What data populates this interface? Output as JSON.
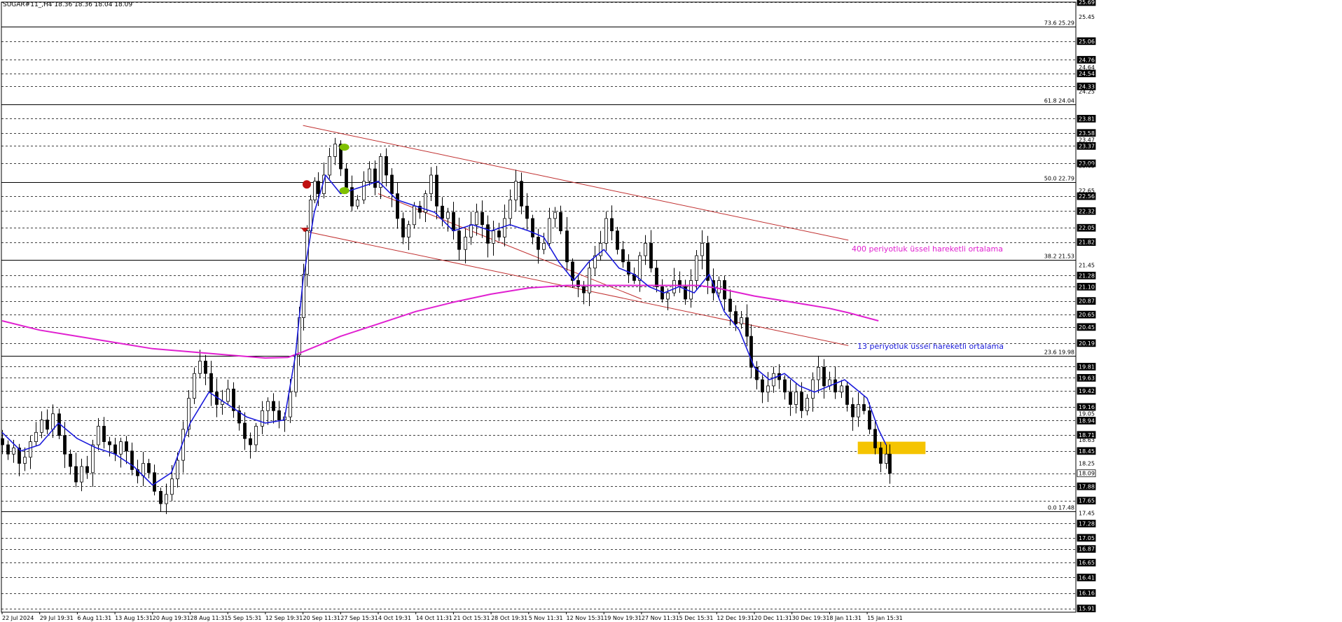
{
  "header": {
    "symbol": "SUGAR#11_,H4",
    "ohlc": "18.36 18.36 18.04 18.09"
  },
  "chart_data": {
    "type": "candlestick",
    "ylim": [
      15.85,
      25.69
    ],
    "price_ticks": [
      "25.69",
      "25.45",
      "25.06",
      "24.76",
      "24.64",
      "24.54",
      "24.33",
      "24.25",
      "23.81",
      "23.58",
      "23.47",
      "23.37",
      "23.09",
      "23.05",
      "22.65",
      "22.56",
      "22.32",
      "22.05",
      "21.82",
      "21.45",
      "21.28",
      "21.10",
      "20.87",
      "20.65",
      "20.45",
      "20.19",
      "19.81",
      "19.63",
      "19.42",
      "19.16",
      "19.05",
      "18.94",
      "18.71",
      "18.63",
      "18.45",
      "18.25",
      "18.09",
      "17.88",
      "17.65",
      "17.45",
      "17.28",
      "17.05",
      "16.87",
      "16.65",
      "16.41",
      "16.16",
      "15.91"
    ],
    "boxed_price_ticks": [
      "25.69",
      "25.06",
      "24.76",
      "24.54",
      "24.33",
      "23.81",
      "23.58",
      "23.37",
      "23.09",
      "22.56",
      "22.32",
      "22.05",
      "21.82",
      "21.28",
      "21.10",
      "20.87",
      "20.65",
      "20.45",
      "20.19",
      "19.81",
      "19.63",
      "19.42",
      "19.16",
      "18.94",
      "18.71",
      "18.45",
      "18.09",
      "17.88",
      "17.65",
      "17.28",
      "17.05",
      "16.87",
      "16.65",
      "16.41",
      "16.16",
      "15.91"
    ],
    "current_price": "18.09",
    "time_labels": [
      "22 Jul 2024",
      "29 Jul 19:31",
      "6 Aug 11:31",
      "13 Aug 15:31",
      "20 Aug 19:31",
      "28 Aug 11:31",
      "5 Sep 15:31",
      "12 Sep 19:31",
      "20 Sep 11:31",
      "27 Sep 15:31",
      "4 Oct 19:31",
      "14 Oct 11:31",
      "21 Oct 15:31",
      "28 Oct 19:31",
      "5 Nov 11:31",
      "12 Nov 15:31",
      "19 Nov 19:31",
      "27 Nov 11:31",
      "5 Dec 15:31",
      "12 Dec 19:31",
      "20 Dec 11:31",
      "30 Dec 19:31",
      "8 Jan 11:31",
      "15 Jan 15:31"
    ],
    "fibonacci": [
      {
        "label": "73.6 25.29",
        "price": 25.29
      },
      {
        "label": "61.8 24.04",
        "price": 24.04
      },
      {
        "label": "50.0 22.79",
        "price": 22.79
      },
      {
        "label": "38.2 21.53",
        "price": 21.53
      },
      {
        "label": "23.6 19.98",
        "price": 19.98
      },
      {
        "label": "0.0 17.48",
        "price": 17.48
      }
    ],
    "channel_lines": [
      {
        "from": [
          8,
          23.7
        ],
        "to": [
          22.5,
          21.85
        ]
      },
      {
        "from": [
          8,
          22.0
        ],
        "to": [
          22.5,
          20.15
        ]
      },
      {
        "from": [
          10,
          22.6
        ],
        "to": [
          17,
          20.9
        ]
      }
    ],
    "ema13": [
      [
        0,
        18.75
      ],
      [
        0.5,
        18.45
      ],
      [
        1,
        18.55
      ],
      [
        1.5,
        18.9
      ],
      [
        2,
        18.65
      ],
      [
        2.5,
        18.5
      ],
      [
        3,
        18.4
      ],
      [
        3.5,
        18.2
      ],
      [
        4,
        17.9
      ],
      [
        4.5,
        18.1
      ],
      [
        5,
        18.9
      ],
      [
        5.5,
        19.4
      ],
      [
        6,
        19.2
      ],
      [
        6.5,
        19.0
      ],
      [
        7,
        18.9
      ],
      [
        7.5,
        18.95
      ],
      [
        7.8,
        20.0
      ],
      [
        8,
        21.2
      ],
      [
        8.3,
        22.3
      ],
      [
        8.6,
        22.9
      ],
      [
        9,
        22.6
      ],
      [
        9.5,
        22.7
      ],
      [
        10,
        22.8
      ],
      [
        10.5,
        22.5
      ],
      [
        11,
        22.4
      ],
      [
        11.5,
        22.3
      ],
      [
        12,
        22.0
      ],
      [
        12.5,
        22.1
      ],
      [
        13,
        22.0
      ],
      [
        13.5,
        22.1
      ],
      [
        14,
        22.0
      ],
      [
        14.4,
        21.9
      ],
      [
        14.8,
        21.5
      ],
      [
        15.2,
        21.2
      ],
      [
        15.6,
        21.5
      ],
      [
        16,
        21.7
      ],
      [
        16.4,
        21.4
      ],
      [
        16.8,
        21.3
      ],
      [
        17.2,
        21.1
      ],
      [
        17.6,
        21.0
      ],
      [
        18,
        21.1
      ],
      [
        18.4,
        21.0
      ],
      [
        18.8,
        21.3
      ],
      [
        19.2,
        20.7
      ],
      [
        19.6,
        20.4
      ],
      [
        20,
        19.8
      ],
      [
        20.4,
        19.6
      ],
      [
        20.8,
        19.7
      ],
      [
        21.2,
        19.5
      ],
      [
        21.6,
        19.4
      ],
      [
        22,
        19.5
      ],
      [
        22.4,
        19.6
      ],
      [
        22.8,
        19.4
      ],
      [
        23,
        19.3
      ],
      [
        23.3,
        18.8
      ],
      [
        23.5,
        18.55
      ]
    ],
    "ema400": [
      [
        0,
        20.55
      ],
      [
        1,
        20.4
      ],
      [
        2,
        20.3
      ],
      [
        3,
        20.2
      ],
      [
        4,
        20.1
      ],
      [
        5,
        20.05
      ],
      [
        6,
        20.0
      ],
      [
        7,
        19.95
      ],
      [
        7.6,
        19.96
      ],
      [
        8,
        20.05
      ],
      [
        9,
        20.3
      ],
      [
        10,
        20.5
      ],
      [
        11,
        20.7
      ],
      [
        12,
        20.85
      ],
      [
        13,
        20.98
      ],
      [
        14,
        21.08
      ],
      [
        15,
        21.12
      ],
      [
        16,
        21.12
      ],
      [
        17,
        21.12
      ],
      [
        18,
        21.12
      ],
      [
        18.5,
        21.12
      ],
      [
        19,
        21.08
      ],
      [
        20,
        20.95
      ],
      [
        21,
        20.85
      ],
      [
        22,
        20.75
      ],
      [
        22.5,
        20.68
      ],
      [
        23.3,
        20.55
      ]
    ],
    "candles": [
      [
        0.0,
        18.55
      ],
      [
        0.15,
        18.4
      ],
      [
        0.3,
        18.5
      ],
      [
        0.45,
        18.25
      ],
      [
        0.6,
        18.35
      ],
      [
        0.75,
        18.6
      ],
      [
        0.9,
        18.75
      ],
      [
        1.05,
        18.95
      ],
      [
        1.2,
        18.8
      ],
      [
        1.35,
        19.05
      ],
      [
        1.5,
        18.7
      ],
      [
        1.65,
        18.4
      ],
      [
        1.8,
        18.2
      ],
      [
        1.95,
        17.95
      ],
      [
        2.1,
        18.2
      ],
      [
        2.25,
        18.1
      ],
      [
        2.4,
        18.55
      ],
      [
        2.55,
        18.85
      ],
      [
        2.7,
        18.6
      ],
      [
        2.85,
        18.55
      ],
      [
        3.0,
        18.4
      ],
      [
        3.15,
        18.6
      ],
      [
        3.3,
        18.45
      ],
      [
        3.45,
        18.15
      ],
      [
        3.6,
        18.05
      ],
      [
        3.75,
        18.25
      ],
      [
        3.9,
        18.1
      ],
      [
        4.05,
        17.8
      ],
      [
        4.2,
        17.6
      ],
      [
        4.35,
        17.75
      ],
      [
        4.5,
        18.0
      ],
      [
        4.65,
        18.3
      ],
      [
        4.8,
        18.8
      ],
      [
        4.95,
        19.3
      ],
      [
        5.1,
        19.7
      ],
      [
        5.25,
        19.9
      ],
      [
        5.4,
        19.7
      ],
      [
        5.55,
        19.4
      ],
      [
        5.7,
        19.2
      ],
      [
        5.85,
        19.25
      ],
      [
        6.0,
        19.45
      ],
      [
        6.15,
        19.1
      ],
      [
        6.3,
        18.9
      ],
      [
        6.45,
        18.65
      ],
      [
        6.6,
        18.55
      ],
      [
        6.75,
        18.85
      ],
      [
        6.9,
        19.1
      ],
      [
        7.05,
        19.25
      ],
      [
        7.2,
        19.1
      ],
      [
        7.35,
        18.95
      ],
      [
        7.5,
        19.0
      ],
      [
        7.65,
        19.4
      ],
      [
        7.8,
        20.0
      ],
      [
        7.9,
        20.6
      ],
      [
        8.0,
        21.3
      ],
      [
        8.1,
        22.0
      ],
      [
        8.2,
        22.5
      ],
      [
        8.3,
        22.8
      ],
      [
        8.4,
        22.6
      ],
      [
        8.55,
        22.9
      ],
      [
        8.7,
        23.2
      ],
      [
        8.85,
        23.4
      ],
      [
        9.0,
        23.0
      ],
      [
        9.15,
        22.7
      ],
      [
        9.3,
        22.4
      ],
      [
        9.45,
        22.5
      ],
      [
        9.6,
        22.8
      ],
      [
        9.75,
        23.0
      ],
      [
        9.9,
        22.7
      ],
      [
        10.05,
        23.2
      ],
      [
        10.2,
        22.9
      ],
      [
        10.35,
        22.6
      ],
      [
        10.5,
        22.2
      ],
      [
        10.65,
        21.9
      ],
      [
        10.8,
        22.1
      ],
      [
        10.95,
        22.4
      ],
      [
        11.1,
        22.3
      ],
      [
        11.25,
        22.6
      ],
      [
        11.4,
        22.9
      ],
      [
        11.55,
        22.4
      ],
      [
        11.7,
        22.2
      ],
      [
        11.85,
        22.3
      ],
      [
        12.0,
        22.0
      ],
      [
        12.15,
        21.7
      ],
      [
        12.3,
        21.9
      ],
      [
        12.45,
        22.1
      ],
      [
        12.6,
        22.3
      ],
      [
        12.75,
        22.1
      ],
      [
        12.9,
        21.8
      ],
      [
        13.05,
        22.0
      ],
      [
        13.2,
        21.9
      ],
      [
        13.35,
        22.2
      ],
      [
        13.5,
        22.5
      ],
      [
        13.65,
        22.8
      ],
      [
        13.8,
        22.4
      ],
      [
        13.95,
        22.2
      ],
      [
        14.1,
        21.9
      ],
      [
        14.25,
        21.7
      ],
      [
        14.4,
        21.8
      ],
      [
        14.55,
        22.2
      ],
      [
        14.7,
        22.3
      ],
      [
        14.85,
        22.0
      ],
      [
        15.0,
        21.5
      ],
      [
        15.15,
        21.2
      ],
      [
        15.3,
        21.1
      ],
      [
        15.45,
        21.0
      ],
      [
        15.6,
        21.4
      ],
      [
        15.75,
        21.6
      ],
      [
        15.9,
        21.8
      ],
      [
        16.05,
        22.2
      ],
      [
        16.2,
        22.0
      ],
      [
        16.35,
        21.7
      ],
      [
        16.5,
        21.5
      ],
      [
        16.65,
        21.3
      ],
      [
        16.8,
        21.2
      ],
      [
        16.95,
        21.6
      ],
      [
        17.1,
        21.8
      ],
      [
        17.25,
        21.4
      ],
      [
        17.4,
        21.1
      ],
      [
        17.55,
        20.9
      ],
      [
        17.7,
        21.0
      ],
      [
        17.85,
        21.2
      ],
      [
        18.0,
        21.1
      ],
      [
        18.15,
        20.9
      ],
      [
        18.3,
        21.2
      ],
      [
        18.45,
        21.6
      ],
      [
        18.6,
        21.8
      ],
      [
        18.75,
        21.2
      ],
      [
        18.9,
        21.0
      ],
      [
        19.05,
        21.2
      ],
      [
        19.2,
        20.9
      ],
      [
        19.35,
        20.7
      ],
      [
        19.5,
        20.5
      ],
      [
        19.65,
        20.6
      ],
      [
        19.8,
        20.3
      ],
      [
        19.9,
        19.8
      ],
      [
        20.05,
        19.6
      ],
      [
        20.2,
        19.4
      ],
      [
        20.35,
        19.5
      ],
      [
        20.5,
        19.7
      ],
      [
        20.65,
        19.6
      ],
      [
        20.8,
        19.4
      ],
      [
        20.95,
        19.2
      ],
      [
        21.1,
        19.4
      ],
      [
        21.25,
        19.1
      ],
      [
        21.4,
        19.3
      ],
      [
        21.55,
        19.6
      ],
      [
        21.7,
        19.8
      ],
      [
        21.85,
        19.5
      ],
      [
        22.0,
        19.6
      ],
      [
        22.15,
        19.4
      ],
      [
        22.3,
        19.5
      ],
      [
        22.45,
        19.2
      ],
      [
        22.6,
        19.0
      ],
      [
        22.75,
        19.2
      ],
      [
        22.9,
        19.1
      ],
      [
        23.05,
        18.8
      ],
      [
        23.2,
        18.5
      ],
      [
        23.35,
        18.25
      ],
      [
        23.5,
        18.4
      ],
      [
        23.6,
        18.09
      ]
    ],
    "markers": [
      {
        "name": "red-circle",
        "t": 8.1,
        "p": 22.75,
        "color": "#c01010"
      },
      {
        "name": "red-arrow",
        "t": 8.05,
        "p": 22.05,
        "color": "#c01010"
      },
      {
        "name": "green-circle-upper",
        "t": 9.1,
        "p": 23.35,
        "color": "#7fc000"
      },
      {
        "name": "green-circle-lower",
        "t": 9.1,
        "p": 22.65,
        "color": "#7fc000"
      }
    ],
    "highlight_zone": {
      "t_from": 22.75,
      "t_to": 24.55,
      "p_from": 18.4,
      "p_to": 18.6,
      "color": "#f5c400"
    },
    "annotations": {
      "ema400_label": "400 periyotluk üssel hareketli ortalama",
      "ema13_label": "13 periyotluk üssel hareketli ortalama"
    },
    "colors": {
      "ema13": "#1a1adb",
      "ema400": "#e020d0",
      "channel": "#c03030",
      "candles": "#000000",
      "gridline": "#000000"
    }
  }
}
